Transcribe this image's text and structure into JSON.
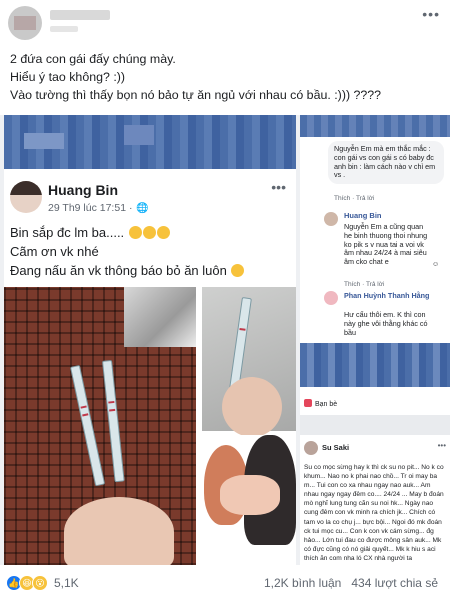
{
  "caption": {
    "line1": "2 đứa con gái đấy chúng mày.",
    "line2": "Hiểu ý tao không? :))",
    "line3": "Vào tường thì thấy bọn nó bảo tự ăn ngủ với nhau có bầu. :))) ????"
  },
  "post": {
    "author": "Huang Bin",
    "time": "29 Th9 lúc 17:51 · ",
    "line1": "Bin sắp đc lm ba.....",
    "line2": "Cãm ơn vk nhé",
    "line3": "Đang nấu ăn vk thông báo bỏ ăn luôn"
  },
  "comments_panel": {
    "c1_author": "Nguyễn Em",
    "c1_text": "Nguyễn Em mà em thắc mắc : con gái vs con gái s có baby đc anh bin : làm cách nào v chỉ em vs .",
    "like": "Thích",
    "reply": "Trả lời",
    "c2_author": "Huang Bin",
    "c2_text": "Nguyễn Em a cũng quan he binh thuong thoi nhung ko pik s v nua tai a voi vk âm nhau 24/24 à mai siêu âm cko chat e",
    "c3_author": "Phan Huỳnh Thanh Hằng",
    "c3_text": "Hư cẩu thôi em. K thì con này ghe vôi thằng khác có bầu"
  },
  "friend_panel": {
    "friend_label": "Bạn bè",
    "name": "Su Saki",
    "body": "Su co mọc sừng hay k thì ck su no pit... No k co khum... Nao no k phai nao chồ... Tr oi may ba m... Tui con co xa nhau ngay nao auk... Am nhau ngay ngay đêm co.... 24/24 ... May b đoán mò nghĩ lung tung cãn su noi hk... Ngày nao cung đêm con vk minh ra chích jk... Chích có tam vo la co chụ j... bực bội... Ngoi đó mk đoán ck tui mọc cu... Con k con vk cám sừng... đg hảo... Lớn tui đau co được mông sân auk... Mk có đực cũng có nó giải quyết... Mk k hiu s aci thích ăn com nha ló CX nhà người ta"
  },
  "footer": {
    "reactions_count": "5,1K",
    "comments": "1,2K bình luận",
    "shares": "434 lượt chia sẻ"
  },
  "colors": {
    "fb_blue": "#1877f2",
    "link_blue": "#385898",
    "text_gray": "#606770"
  }
}
